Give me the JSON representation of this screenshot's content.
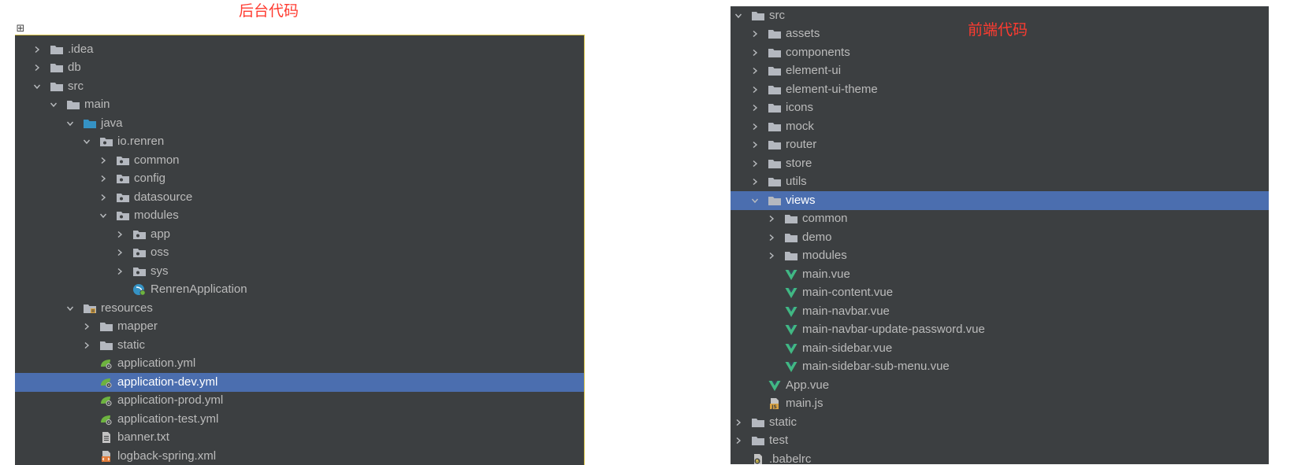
{
  "captions": {
    "backend": "后台代码",
    "frontend": "前端代码"
  },
  "expand_marker": "⊞",
  "backend_tree": [
    {
      "label": ".idea",
      "depth": 0,
      "arrow": "collapsed",
      "icon": "folder"
    },
    {
      "label": "db",
      "depth": 0,
      "arrow": "collapsed",
      "icon": "folder"
    },
    {
      "label": "src",
      "depth": 0,
      "arrow": "expanded",
      "icon": "folder"
    },
    {
      "label": "main",
      "depth": 1,
      "arrow": "expanded",
      "icon": "folder"
    },
    {
      "label": "java",
      "depth": 2,
      "arrow": "expanded",
      "icon": "source-folder"
    },
    {
      "label": "io.renren",
      "depth": 3,
      "arrow": "expanded",
      "icon": "package"
    },
    {
      "label": "common",
      "depth": 4,
      "arrow": "collapsed",
      "icon": "package"
    },
    {
      "label": "config",
      "depth": 4,
      "arrow": "collapsed",
      "icon": "package"
    },
    {
      "label": "datasource",
      "depth": 4,
      "arrow": "collapsed",
      "icon": "package"
    },
    {
      "label": "modules",
      "depth": 4,
      "arrow": "expanded",
      "icon": "package"
    },
    {
      "label": "app",
      "depth": 5,
      "arrow": "collapsed",
      "icon": "package"
    },
    {
      "label": "oss",
      "depth": 5,
      "arrow": "collapsed",
      "icon": "package"
    },
    {
      "label": "sys",
      "depth": 5,
      "arrow": "collapsed",
      "icon": "package"
    },
    {
      "label": "RenrenApplication",
      "depth": 5,
      "arrow": "none",
      "icon": "spring-boot-class"
    },
    {
      "label": "resources",
      "depth": 2,
      "arrow": "expanded",
      "icon": "resources-folder"
    },
    {
      "label": "mapper",
      "depth": 3,
      "arrow": "collapsed",
      "icon": "folder"
    },
    {
      "label": "static",
      "depth": 3,
      "arrow": "collapsed",
      "icon": "folder"
    },
    {
      "label": "application.yml",
      "depth": 3,
      "arrow": "none",
      "icon": "spring-config"
    },
    {
      "label": "application-dev.yml",
      "depth": 3,
      "arrow": "none",
      "icon": "spring-config",
      "selected": true
    },
    {
      "label": "application-prod.yml",
      "depth": 3,
      "arrow": "none",
      "icon": "spring-config"
    },
    {
      "label": "application-test.yml",
      "depth": 3,
      "arrow": "none",
      "icon": "spring-config"
    },
    {
      "label": "banner.txt",
      "depth": 3,
      "arrow": "none",
      "icon": "text-file"
    },
    {
      "label": "logback-spring.xml",
      "depth": 3,
      "arrow": "none",
      "icon": "xml-file"
    }
  ],
  "frontend_tree": [
    {
      "label": "src",
      "depth": 0,
      "arrow": "expanded",
      "icon": "folder"
    },
    {
      "label": "assets",
      "depth": 1,
      "arrow": "collapsed",
      "icon": "folder"
    },
    {
      "label": "components",
      "depth": 1,
      "arrow": "collapsed",
      "icon": "folder"
    },
    {
      "label": "element-ui",
      "depth": 1,
      "arrow": "collapsed",
      "icon": "folder"
    },
    {
      "label": "element-ui-theme",
      "depth": 1,
      "arrow": "collapsed",
      "icon": "folder"
    },
    {
      "label": "icons",
      "depth": 1,
      "arrow": "collapsed",
      "icon": "folder"
    },
    {
      "label": "mock",
      "depth": 1,
      "arrow": "collapsed",
      "icon": "folder"
    },
    {
      "label": "router",
      "depth": 1,
      "arrow": "collapsed",
      "icon": "folder"
    },
    {
      "label": "store",
      "depth": 1,
      "arrow": "collapsed",
      "icon": "folder"
    },
    {
      "label": "utils",
      "depth": 1,
      "arrow": "collapsed",
      "icon": "folder"
    },
    {
      "label": "views",
      "depth": 1,
      "arrow": "expanded",
      "icon": "folder",
      "selected": true
    },
    {
      "label": "common",
      "depth": 2,
      "arrow": "collapsed",
      "icon": "folder"
    },
    {
      "label": "demo",
      "depth": 2,
      "arrow": "collapsed",
      "icon": "folder"
    },
    {
      "label": "modules",
      "depth": 2,
      "arrow": "collapsed",
      "icon": "folder"
    },
    {
      "label": "main.vue",
      "depth": 2,
      "arrow": "none",
      "icon": "vue-file"
    },
    {
      "label": "main-content.vue",
      "depth": 2,
      "arrow": "none",
      "icon": "vue-file"
    },
    {
      "label": "main-navbar.vue",
      "depth": 2,
      "arrow": "none",
      "icon": "vue-file"
    },
    {
      "label": "main-navbar-update-password.vue",
      "depth": 2,
      "arrow": "none",
      "icon": "vue-file"
    },
    {
      "label": "main-sidebar.vue",
      "depth": 2,
      "arrow": "none",
      "icon": "vue-file"
    },
    {
      "label": "main-sidebar-sub-menu.vue",
      "depth": 2,
      "arrow": "none",
      "icon": "vue-file"
    },
    {
      "label": "App.vue",
      "depth": 1,
      "arrow": "none",
      "icon": "vue-file"
    },
    {
      "label": "main.js",
      "depth": 1,
      "arrow": "none",
      "icon": "js-file"
    },
    {
      "label": "static",
      "depth": 0,
      "arrow": "collapsed",
      "icon": "folder"
    },
    {
      "label": "test",
      "depth": 0,
      "arrow": "collapsed",
      "icon": "folder"
    },
    {
      "label": ".babelrc",
      "depth": 0,
      "arrow": "none",
      "icon": "babelrc-file"
    }
  ],
  "colors": {
    "panel_bg": "#3c3f41",
    "selection": "#4b6eaf",
    "text": "#bbbbbb",
    "caption": "#ff3b30",
    "vue_green": "#41b883",
    "folder_grey": "#b4b8bf",
    "source_blue": "#3592c4"
  }
}
